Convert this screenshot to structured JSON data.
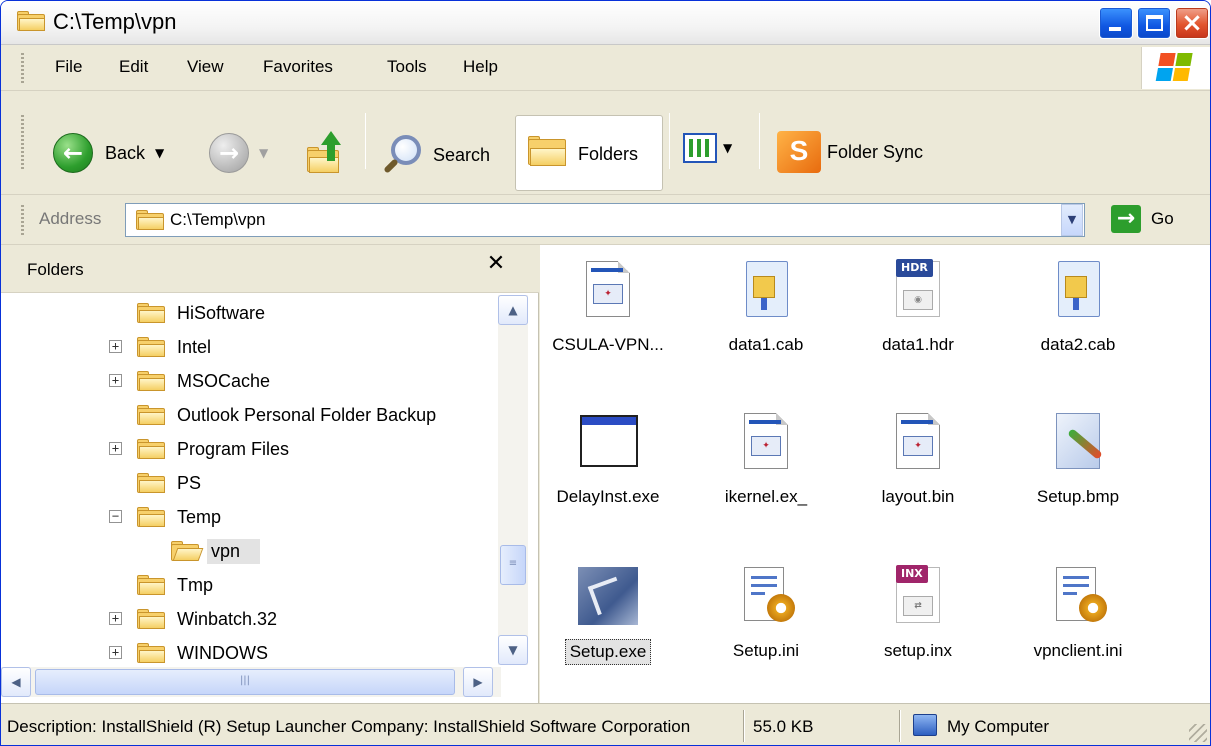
{
  "window": {
    "title": "C:\\Temp\\vpn"
  },
  "menu": {
    "items": [
      "File",
      "Edit",
      "View",
      "Favorites",
      "Tools",
      "Help"
    ]
  },
  "toolbar": {
    "back_label": "Back",
    "search_label": "Search",
    "folders_label": "Folders",
    "folder_sync_label": "Folder Sync"
  },
  "address": {
    "label": "Address",
    "value": "C:\\Temp\\vpn",
    "go_label": "Go"
  },
  "folders_pane": {
    "title": "Folders",
    "close_glyph": "✕",
    "items": [
      {
        "label": "HiSoftware",
        "expander": ""
      },
      {
        "label": "Intel",
        "expander": "+"
      },
      {
        "label": "MSOCache",
        "expander": "+"
      },
      {
        "label": "Outlook Personal Folder Backup",
        "expander": ""
      },
      {
        "label": "Program Files",
        "expander": "+"
      },
      {
        "label": "PS",
        "expander": ""
      },
      {
        "label": "Temp",
        "expander": "−"
      },
      {
        "label": "vpn",
        "expander": "",
        "selected": true
      },
      {
        "label": "Tmp",
        "expander": ""
      },
      {
        "label": "Winbatch.32",
        "expander": "+"
      },
      {
        "label": "WINDOWS",
        "expander": "+"
      }
    ]
  },
  "files": [
    {
      "name": "CSULA-VPN...",
      "icon": "document-icon"
    },
    {
      "name": "data1.cab",
      "icon": "cab-icon"
    },
    {
      "name": "data1.hdr",
      "icon": "hdr-icon",
      "badge": "HDR"
    },
    {
      "name": "data2.cab",
      "icon": "cab-icon"
    },
    {
      "name": "DelayInst.exe",
      "icon": "application-icon"
    },
    {
      "name": "ikernel.ex_",
      "icon": "document-icon"
    },
    {
      "name": "layout.bin",
      "icon": "document-icon"
    },
    {
      "name": "Setup.bmp",
      "icon": "bitmap-icon"
    },
    {
      "name": "Setup.exe",
      "icon": "installshield-icon",
      "selected": true
    },
    {
      "name": "Setup.ini",
      "icon": "ini-icon"
    },
    {
      "name": "setup.inx",
      "icon": "inx-icon",
      "badge": "INX"
    },
    {
      "name": "vpnclient.ini",
      "icon": "ini-icon"
    }
  ],
  "status": {
    "description": "Description: InstallShield (R) Setup Launcher Company: InstallShield Software Corporation",
    "size": "55.0 KB",
    "zone": "My Computer"
  },
  "colors": {
    "titlebar_border": "#0831d9",
    "close_button": "#e2552d",
    "selection_gray": "#e3e3e3",
    "folder_yellow": "#f7d06b"
  }
}
